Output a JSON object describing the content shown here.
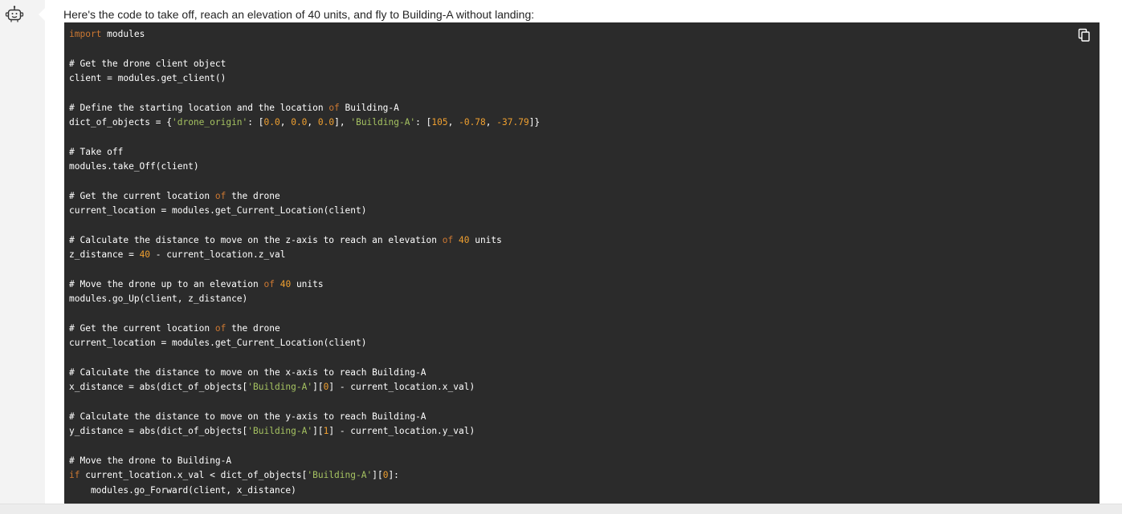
{
  "avatar": {
    "icon": "bot-icon"
  },
  "message": {
    "intro": "Here's the code to take off, reach an elevation of 40 units, and fly to Building-A without landing:"
  },
  "code": {
    "copy_icon": "copy-icon",
    "lines": [
      [
        {
          "t": "import",
          "c": "kw"
        },
        {
          "t": " modules"
        }
      ],
      [],
      [
        {
          "t": "# Get the drone client object"
        }
      ],
      [
        {
          "t": "client = modules.get_client()"
        }
      ],
      [],
      [
        {
          "t": "# Define the starting location and the location "
        },
        {
          "t": "of",
          "c": "kw"
        },
        {
          "t": " Building-A"
        }
      ],
      [
        {
          "t": "dict_of_objects = {"
        },
        {
          "t": "'drone_origin'",
          "c": "str"
        },
        {
          "t": ": ["
        },
        {
          "t": "0.0",
          "c": "num"
        },
        {
          "t": ", "
        },
        {
          "t": "0.0",
          "c": "num"
        },
        {
          "t": ", "
        },
        {
          "t": "0.0",
          "c": "num"
        },
        {
          "t": "], "
        },
        {
          "t": "'Building-A'",
          "c": "str"
        },
        {
          "t": ": ["
        },
        {
          "t": "105",
          "c": "num"
        },
        {
          "t": ", "
        },
        {
          "t": "-0.78",
          "c": "num"
        },
        {
          "t": ", "
        },
        {
          "t": "-37.79",
          "c": "num"
        },
        {
          "t": "]}"
        }
      ],
      [],
      [
        {
          "t": "# Take off"
        }
      ],
      [
        {
          "t": "modules.take_Off(client)"
        }
      ],
      [],
      [
        {
          "t": "# Get the current location "
        },
        {
          "t": "of",
          "c": "kw"
        },
        {
          "t": " the drone"
        }
      ],
      [
        {
          "t": "current_location = modules.get_Current_Location(client)"
        }
      ],
      [],
      [
        {
          "t": "# Calculate the distance to move on the z-axis to reach an elevation "
        },
        {
          "t": "of",
          "c": "kw"
        },
        {
          "t": " "
        },
        {
          "t": "40",
          "c": "num"
        },
        {
          "t": " units"
        }
      ],
      [
        {
          "t": "z_distance = "
        },
        {
          "t": "40",
          "c": "num"
        },
        {
          "t": " - current_location.z_val"
        }
      ],
      [],
      [
        {
          "t": "# Move the drone up to an elevation "
        },
        {
          "t": "of",
          "c": "kw"
        },
        {
          "t": " "
        },
        {
          "t": "40",
          "c": "num"
        },
        {
          "t": " units"
        }
      ],
      [
        {
          "t": "modules.go_Up(client, z_distance)"
        }
      ],
      [],
      [
        {
          "t": "# Get the current location "
        },
        {
          "t": "of",
          "c": "kw"
        },
        {
          "t": " the drone"
        }
      ],
      [
        {
          "t": "current_location = modules.get_Current_Location(client)"
        }
      ],
      [],
      [
        {
          "t": "# Calculate the distance to move on the x-axis to reach Building-A"
        }
      ],
      [
        {
          "t": "x_distance = abs(dict_of_objects["
        },
        {
          "t": "'Building-A'",
          "c": "str"
        },
        {
          "t": "]["
        },
        {
          "t": "0",
          "c": "num"
        },
        {
          "t": "] - current_location.x_val)"
        }
      ],
      [],
      [
        {
          "t": "# Calculate the distance to move on the y-axis to reach Building-A"
        }
      ],
      [
        {
          "t": "y_distance = abs(dict_of_objects["
        },
        {
          "t": "'Building-A'",
          "c": "str"
        },
        {
          "t": "]["
        },
        {
          "t": "1",
          "c": "num"
        },
        {
          "t": "] - current_location.y_val)"
        }
      ],
      [],
      [
        {
          "t": "# Move the drone to Building-A"
        }
      ],
      [
        {
          "t": "if",
          "c": "kw"
        },
        {
          "t": " current_location.x_val < dict_of_objects["
        },
        {
          "t": "'Building-A'",
          "c": "str"
        },
        {
          "t": "]["
        },
        {
          "t": "0",
          "c": "num"
        },
        {
          "t": "]:"
        }
      ],
      [
        {
          "t": "    modules.go_Forward(client, x_distance)"
        }
      ]
    ]
  }
}
